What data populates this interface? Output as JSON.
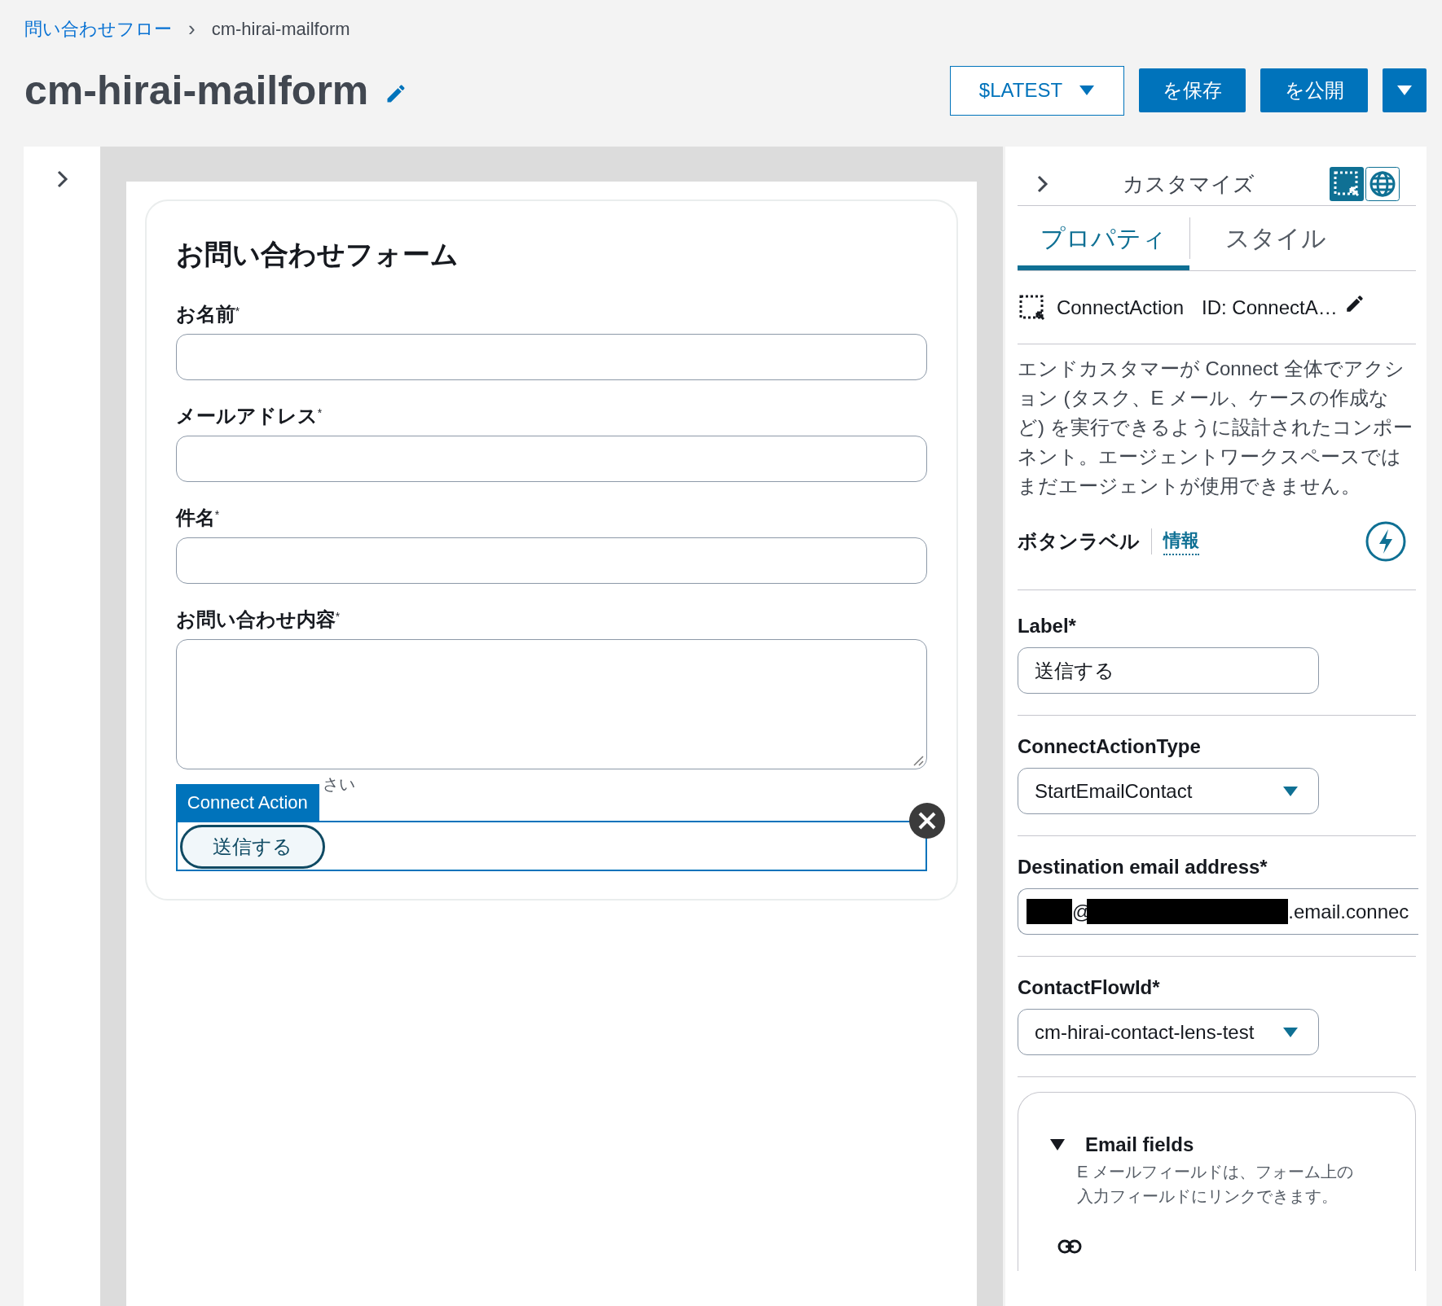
{
  "breadcrumb": {
    "link": "問い合わせフロー",
    "separator": "›",
    "current": "cm-hirai-mailform"
  },
  "header": {
    "title": "cm-hirai-mailform",
    "version": "$LATEST",
    "buttons": [
      "を保存",
      "を公開"
    ]
  },
  "form": {
    "title": "お問い合わせフォーム",
    "fields": [
      {
        "kind": "input",
        "label": "お名前",
        "required_mark": "*"
      },
      {
        "kind": "input",
        "label": "メールアドレス",
        "required_mark": "*"
      },
      {
        "kind": "input",
        "label": "件名",
        "required_mark": "*"
      },
      {
        "kind": "textarea",
        "label": "お問い合わせ内容",
        "required_mark": "*",
        "hint": "さい"
      }
    ],
    "action": {
      "tag": "Connect Action",
      "button": "送信する",
      "selected": true
    }
  },
  "panel": {
    "title": "カスタマイズ",
    "tabs": [
      {
        "label": "プロパティ",
        "selected": true
      },
      {
        "label": "スタイル",
        "selected": false
      }
    ],
    "component": {
      "type": "ConnectAction",
      "id": "ID: ConnectA…"
    },
    "description": "エンドカスタマーが Connect 全体でアクション (タスク、E メール、ケースの作成など) を実行できるように設計されたコンポーネント。エージェントワークスペースではまだエージェントが使用できません。",
    "section": {
      "title": "ボタンラベル",
      "info": "情報"
    },
    "properties": [
      {
        "kind": "input",
        "label": "Label*",
        "value": "送信する"
      },
      {
        "kind": "select",
        "label": "ConnectActionType",
        "value": "StartEmailContact"
      },
      {
        "kind": "redacted",
        "label": "Destination email address*",
        "parts": [
          "@",
          ".email.connec"
        ]
      },
      {
        "kind": "select",
        "label": "ContactFlowId*",
        "value": "cm-hirai-contact-lens-test"
      }
    ],
    "email_fields": {
      "title": "Email fields",
      "expanded": true,
      "description": [
        "E メールフィールドは、フォーム上の",
        "入力フィールドにリンクできます。"
      ]
    }
  }
}
